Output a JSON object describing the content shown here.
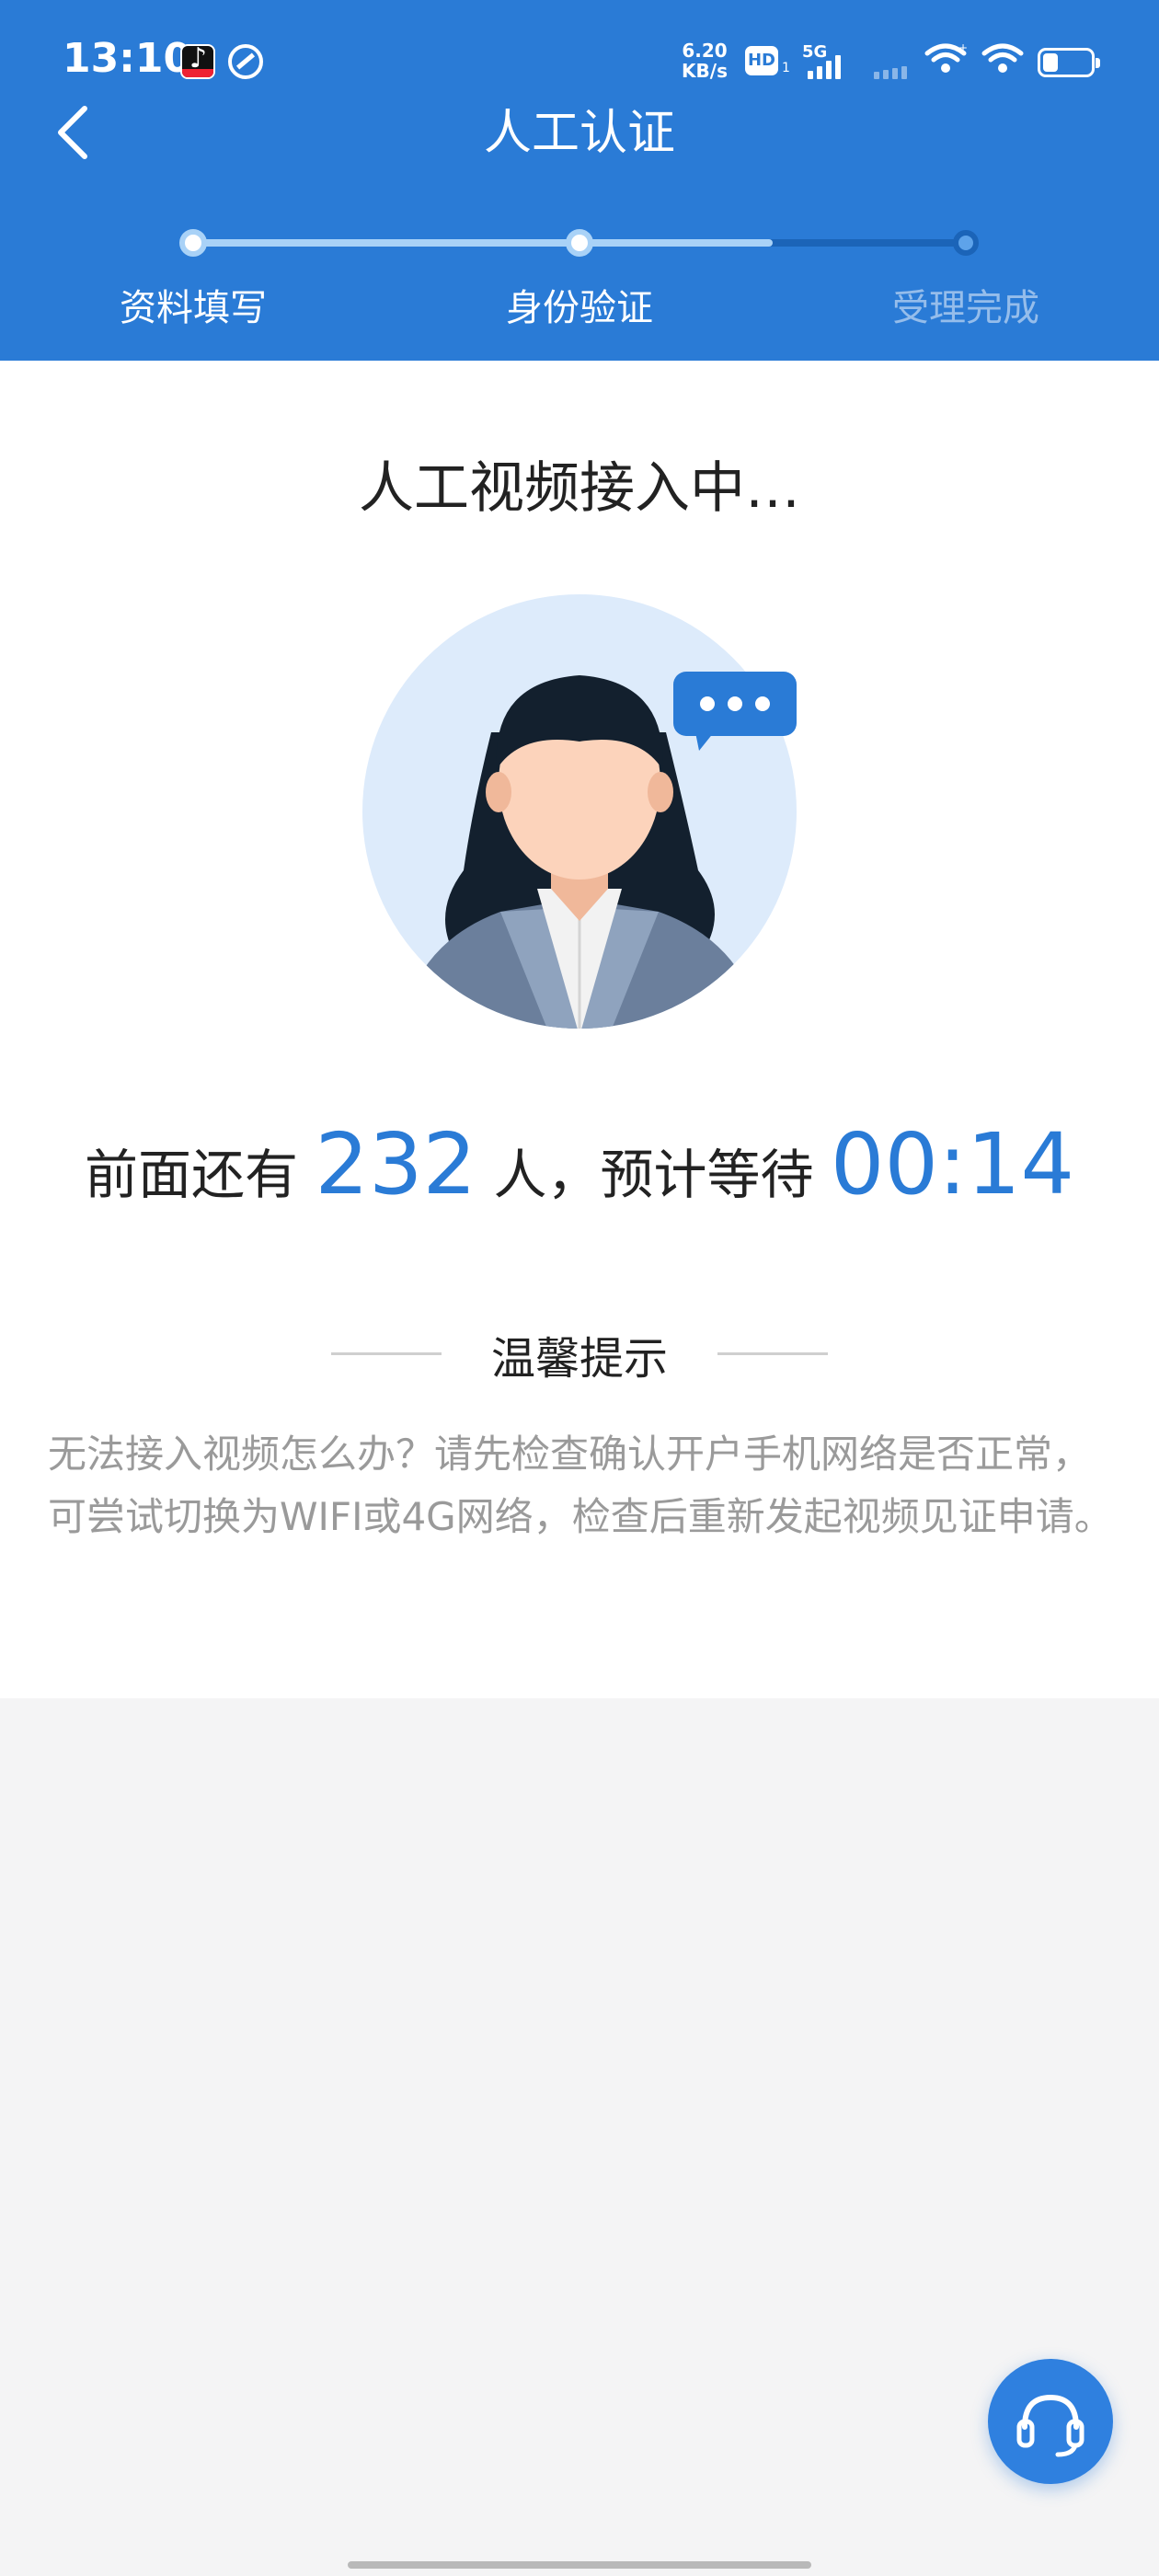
{
  "status_bar": {
    "time": "13:10",
    "net_speed_value": "6.20",
    "net_speed_unit": "KB/s",
    "hd_badge": "HD",
    "sim_index": "1",
    "network_type": "5G",
    "battery_level": 0.3
  },
  "header": {
    "title": "人工认证"
  },
  "steps": {
    "items": [
      {
        "label": "资料填写",
        "state": "done"
      },
      {
        "label": "身份验证",
        "state": "done"
      },
      {
        "label": "受理完成",
        "state": "pending"
      }
    ],
    "progress": 0.75
  },
  "main": {
    "connecting_title": "人工视频接入中…",
    "queue_prefix": "前面还有",
    "queue_count": "232",
    "queue_middle": "人，预计等待",
    "wait_time": "00:14",
    "tip_title": "温馨提示",
    "tip_text": "无法接入视频怎么办？请先检查确认开户手机网络是否正常，可尝试切换为WIFI或4G网络，检查后重新发起视频见证申请。"
  },
  "icons": {
    "back": "chevron-left-icon",
    "service": "headset-icon",
    "avatar": "agent-avatar-icon",
    "chat_bubble": "chat-bubble-icon"
  },
  "colors": {
    "primary": "#2a7bd6",
    "header_bg": "#2a7bd6",
    "tip_text": "#9a9a9a",
    "page_bg": "#f4f4f5"
  }
}
